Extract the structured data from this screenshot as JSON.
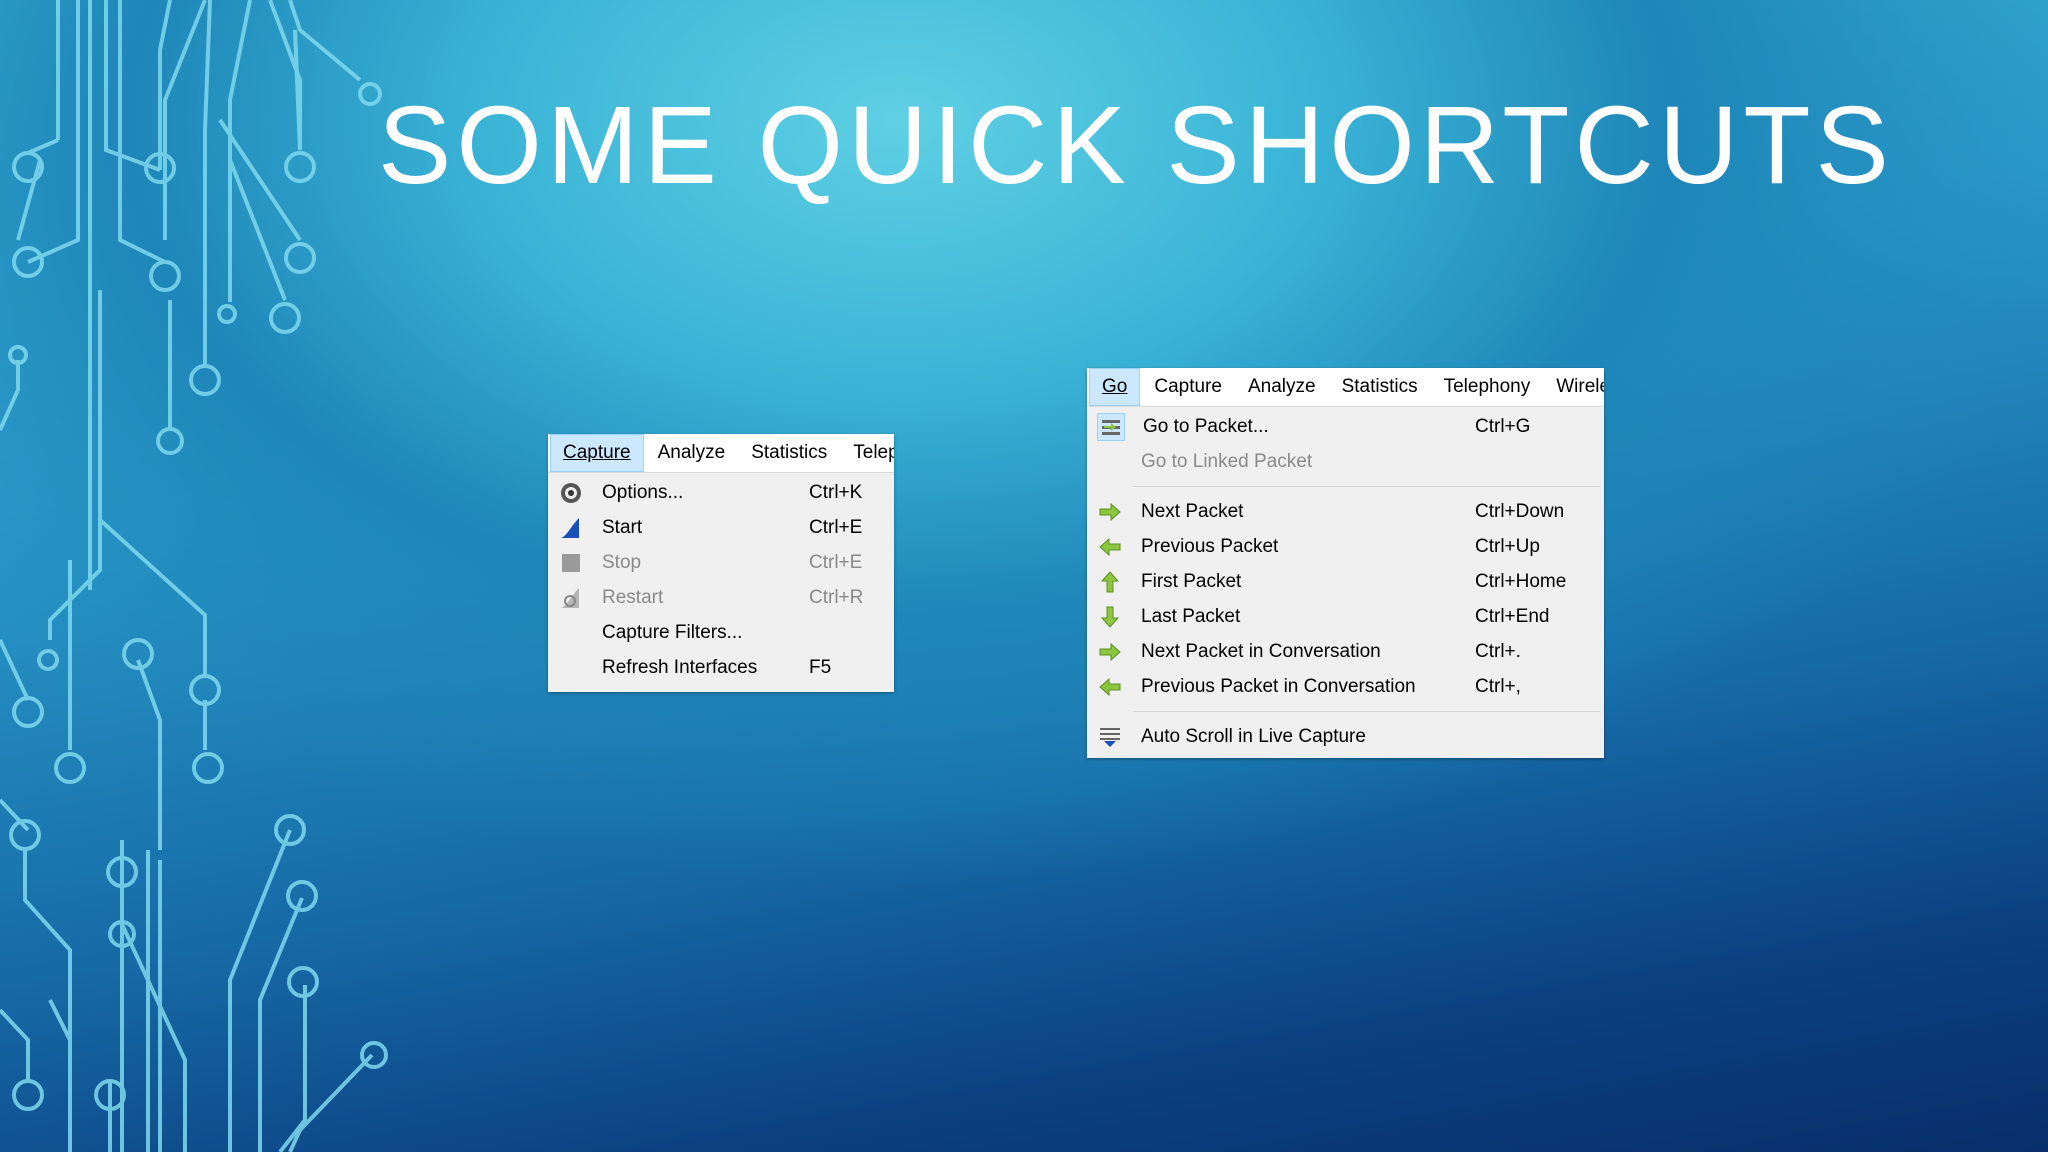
{
  "slide": {
    "title": "SOME QUICK SHORTCUTS"
  },
  "capture_menu": {
    "menubar": [
      "Capture",
      "Analyze",
      "Statistics",
      "Telepl"
    ],
    "items": [
      {
        "label": "Options...",
        "shortcut": "Ctrl+K",
        "icon": "gear-icon",
        "disabled": false
      },
      {
        "label": "Start",
        "shortcut": "Ctrl+E",
        "icon": "shark-fin-icon",
        "disabled": false
      },
      {
        "label": "Stop",
        "shortcut": "Ctrl+E",
        "icon": "stop-square-icon",
        "disabled": true
      },
      {
        "label": "Restart",
        "shortcut": "Ctrl+R",
        "icon": "restart-fin-icon",
        "disabled": true
      },
      {
        "label": "Capture Filters...",
        "shortcut": "",
        "icon": "",
        "disabled": false
      },
      {
        "label": "Refresh Interfaces",
        "shortcut": "F5",
        "icon": "",
        "disabled": false
      }
    ]
  },
  "go_menu": {
    "menubar": [
      "Go",
      "Capture",
      "Analyze",
      "Statistics",
      "Telephony",
      "Wireles"
    ],
    "items": [
      {
        "label": "Go to Packet...",
        "shortcut": "Ctrl+G",
        "icon": "go-to-packet-icon",
        "disabled": false
      },
      {
        "label": "Go to Linked Packet",
        "shortcut": "",
        "icon": "",
        "disabled": true
      },
      {
        "label": "Next Packet",
        "shortcut": "Ctrl+Down",
        "icon": "arrow-right-icon",
        "disabled": false
      },
      {
        "label": "Previous Packet",
        "shortcut": "Ctrl+Up",
        "icon": "arrow-left-icon",
        "disabled": false
      },
      {
        "label": "First Packet",
        "shortcut": "Ctrl+Home",
        "icon": "arrow-up-icon",
        "disabled": false
      },
      {
        "label": "Last Packet",
        "shortcut": "Ctrl+End",
        "icon": "arrow-down-icon",
        "disabled": false
      },
      {
        "label": "Next Packet in Conversation",
        "shortcut": "Ctrl+.",
        "icon": "arrow-right-icon",
        "disabled": false
      },
      {
        "label": "Previous Packet in Conversation",
        "shortcut": "Ctrl+,",
        "icon": "arrow-left-icon",
        "disabled": false
      },
      {
        "label": "Auto Scroll in Live Capture",
        "shortcut": "",
        "icon": "auto-scroll-icon",
        "disabled": false
      }
    ]
  },
  "colors": {
    "arrow_green": "#8cc63f",
    "highlight": "#cce8ff",
    "menu_bg": "#f0f0f0"
  }
}
